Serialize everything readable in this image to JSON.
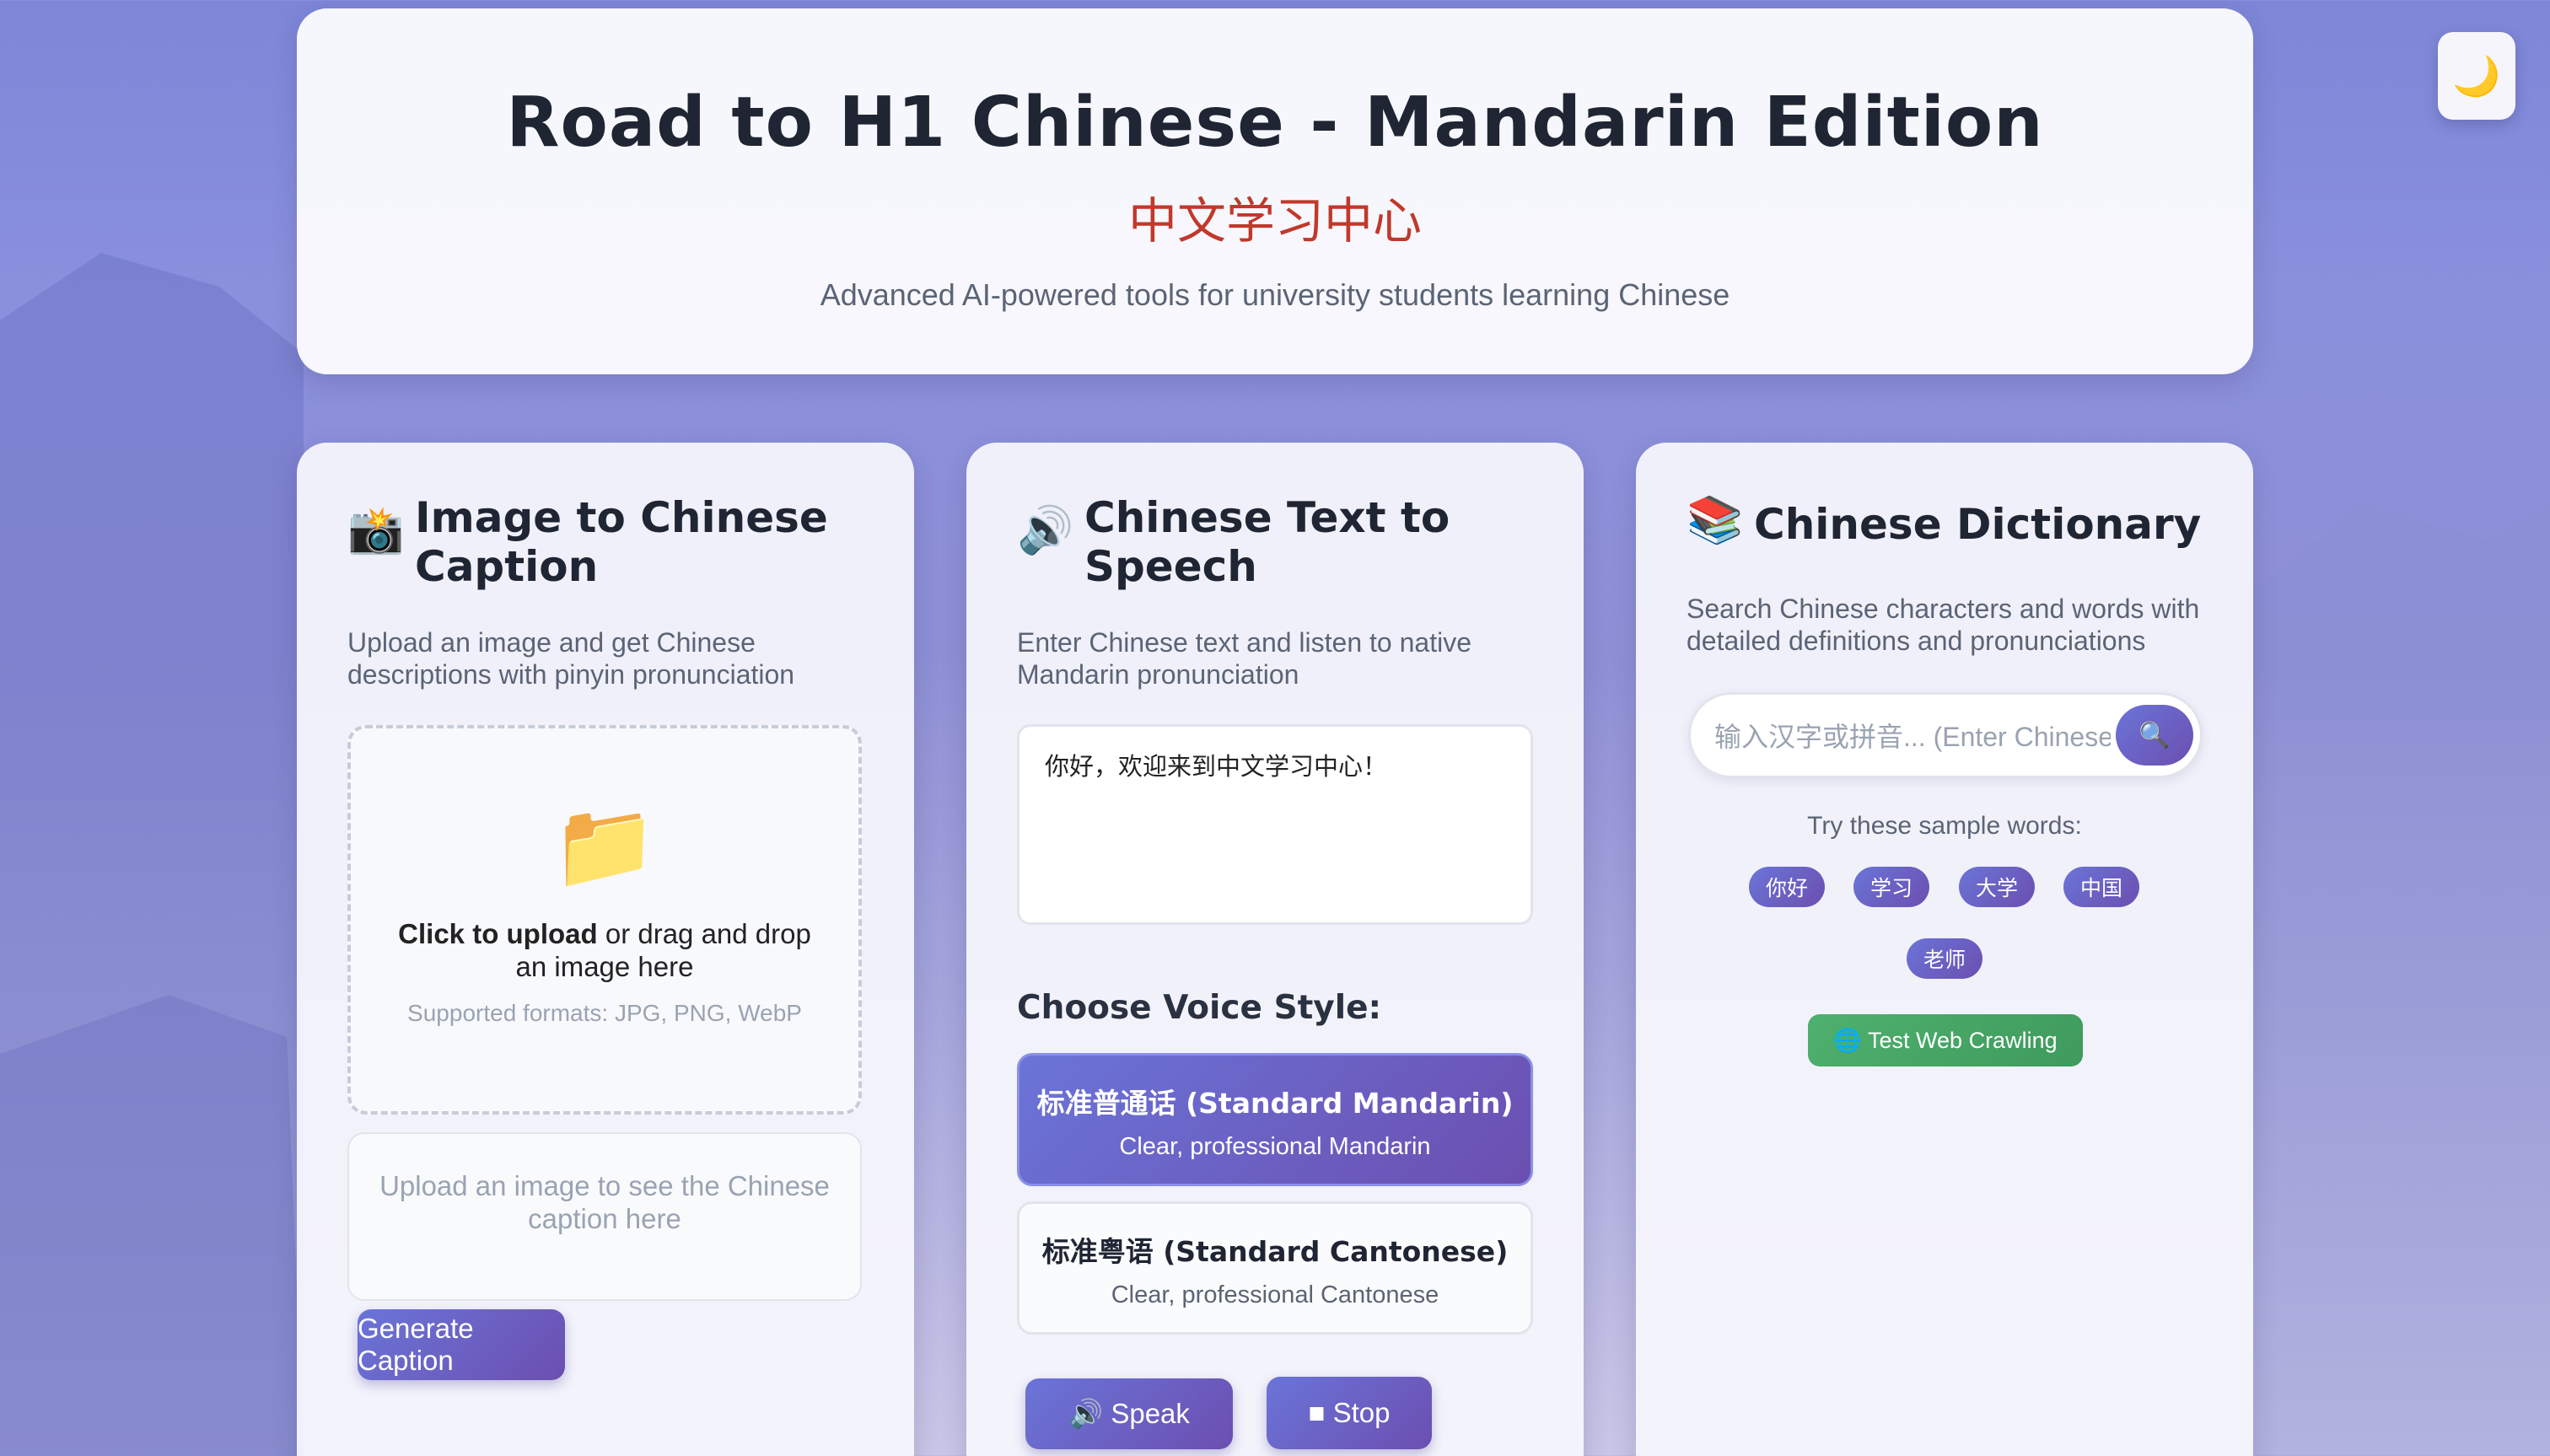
{
  "header": {
    "title": "Road to H1 Chinese - Mandarin Edition",
    "subtitle_zh": "中文学习中心",
    "description": "Advanced AI-powered tools for university students learning Chinese"
  },
  "theme_toggle": {
    "icon": "moon-icon",
    "glyph": "🌙"
  },
  "caption_card": {
    "icon": "camera-icon",
    "icon_glyph": "📸",
    "title": "Image to Chinese Caption",
    "description": "Upload an image and get Chinese descriptions with pinyin pronunciation",
    "upload": {
      "icon": "folder-icon",
      "icon_glyph": "📁",
      "bold": "Click to upload",
      "rest": " or drag and drop an image here",
      "formats": "Supported formats: JPG, PNG, WebP"
    },
    "caption_placeholder": "Upload an image to see the Chinese caption here",
    "generate_label": "Generate Caption"
  },
  "tts_card": {
    "icon": "speaker-icon",
    "icon_glyph": "🔊",
    "title": "Chinese Text to Speech",
    "description": "Enter Chinese text and listen to native Mandarin pronunciation",
    "text_value": "你好，欢迎来到中文学习中心！",
    "voice_heading": "Choose Voice Style:",
    "voices": [
      {
        "name": "标准普通话 (Standard Mandarin)",
        "desc": "Clear, professional Mandarin",
        "selected": true
      },
      {
        "name": "标准粤语 (Standard Cantonese)",
        "desc": "Clear, professional Cantonese",
        "selected": false
      }
    ],
    "speak_label": "🔊 Speak",
    "stop_label": "■ Stop"
  },
  "dictionary_card": {
    "icon": "books-icon",
    "icon_glyph": "📚",
    "title": "Chinese Dictionary",
    "description": "Search Chinese characters and words with detailed definitions and pronunciations",
    "search_placeholder": "输入汉字或拼音... (Enter Chinese",
    "search_glyph": "🔍",
    "sample_heading": "Try these sample words:",
    "samples": [
      "你好",
      "学习",
      "大学",
      "中国",
      "老师"
    ],
    "test_label": "🌐 Test Web Crawling"
  },
  "colors": {
    "accent": "#6b74d8",
    "accent_dark": "#6b4fb0",
    "zh_red": "#c0392b",
    "green": "#4fb16e"
  }
}
